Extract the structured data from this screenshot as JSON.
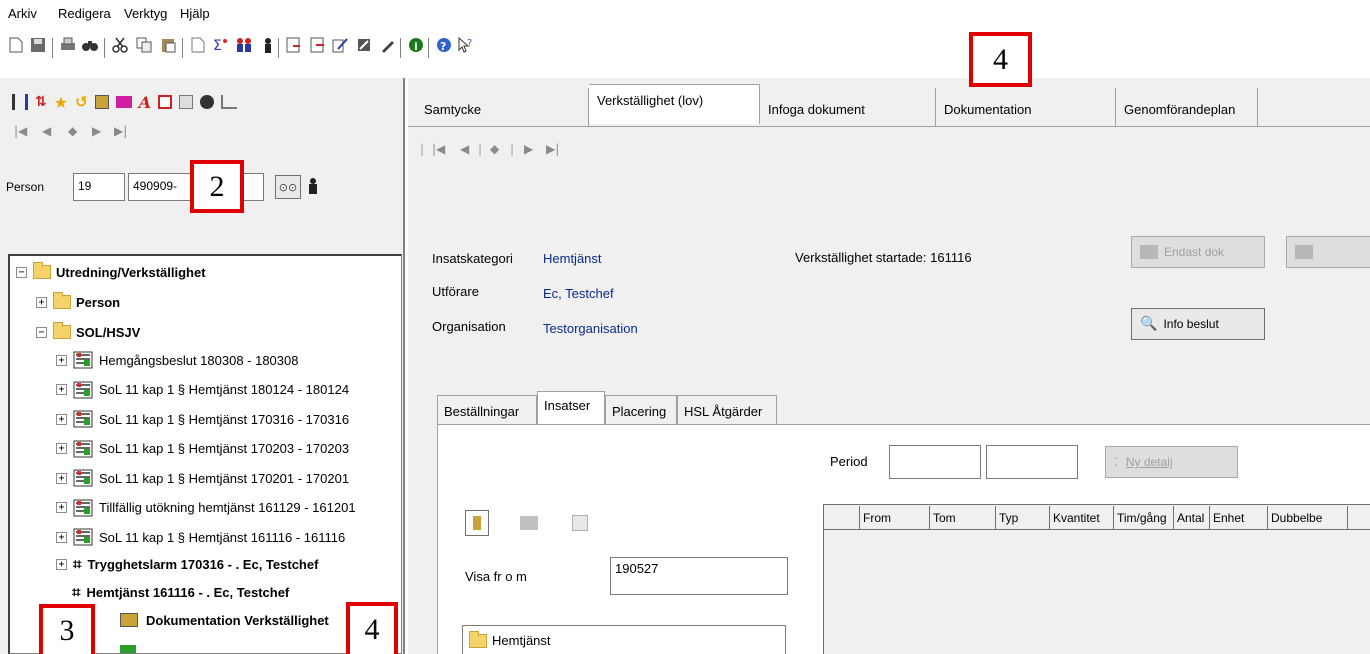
{
  "menu": {
    "items": [
      "Arkiv",
      "Redigera",
      "Verktyg",
      "Hjälp"
    ]
  },
  "left": {
    "person_label": "Person",
    "century": "19",
    "personnr": "490909-",
    "tree": {
      "root": "Utredning/Verkställighet",
      "person": "Person",
      "sol": "SOL/HSJV",
      "items": [
        "Hemgångsbeslut 180308 - 180308",
        "SoL 11 kap 1 § Hemtjänst 180124 - 180124",
        "SoL 11 kap 1 § Hemtjänst 170316 - 170316",
        "SoL 11 kap 1 § Hemtjänst 170203 - 170203",
        "SoL 11 kap 1 § Hemtjänst 170201 - 170201",
        "Tillfällig utökning hemtjänst 161129 - 161201",
        "SoL 11 kap 1 § Hemtjänst 161116 - 161116"
      ],
      "trygghetslarm": "Trygghetslarm 170316 - . Ec, Testchef",
      "hemtjanst": "Hemtjänst 161116 - . Ec, Testchef",
      "dokumentation": "Dokumentation Verkställighet"
    }
  },
  "right": {
    "tabs": [
      "Samtycke",
      "Verkställighet (lov)",
      "Infoga dokument",
      "Dokumentation",
      "Genomförandeplan"
    ],
    "insatskategori_label": "Insatskategori",
    "insatskategori": "Hemtjänst",
    "utforare_label": "Utförare",
    "utforare": "Ec, Testchef",
    "organisation_label": "Organisation",
    "organisation": "Testorganisation",
    "startad": "Verkställighet startade: 161116",
    "endast_dok": "Endast dok",
    "info_beslut": "Info beslut",
    "inner_tabs": [
      "Beställningar",
      "Insatser",
      "Placering",
      "HSL Åtgärder"
    ],
    "period_label": "Period",
    "ny_detalj": "Ny detalj",
    "visa_label": "Visa fr o m",
    "visa_value": "190527",
    "list_item": "Hemtjänst",
    "columns": [
      "From",
      "Tom",
      "Typ",
      "Kvantitet",
      "Tim/gång",
      "Antal",
      "Enhet",
      "Dubbelbe"
    ]
  },
  "markers": {
    "m2": "2",
    "m3": "3",
    "m4a": "4",
    "m4b": "4"
  }
}
